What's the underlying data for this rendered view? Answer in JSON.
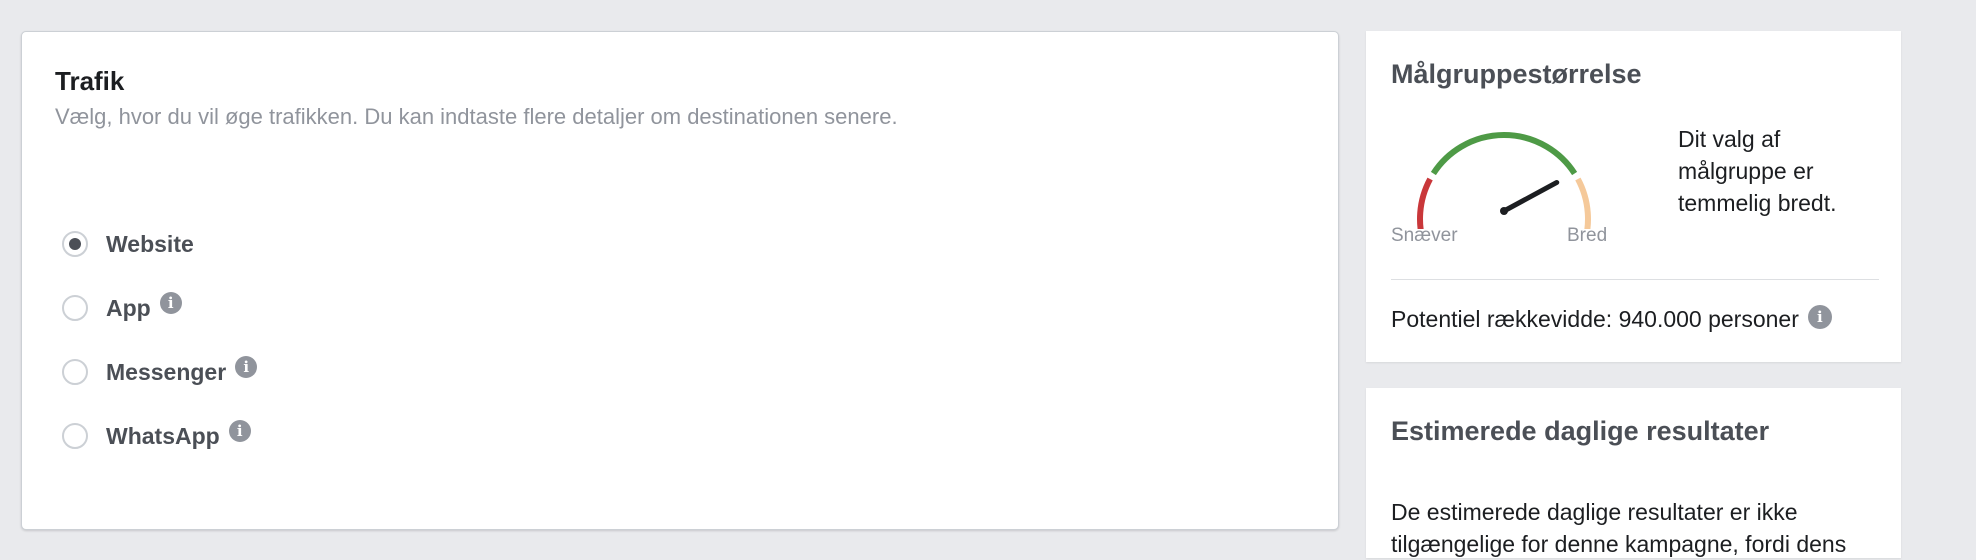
{
  "traffic": {
    "title": "Trafik",
    "subtitle": "Vælg, hvor du vil øge trafikken. Du kan indtaste flere detaljer om destinationen senere.",
    "options": [
      {
        "label": "Website",
        "checked": true,
        "info": false
      },
      {
        "label": "App",
        "checked": false,
        "info": true
      },
      {
        "label": "Messenger",
        "checked": false,
        "info": true
      },
      {
        "label": "WhatsApp",
        "checked": false,
        "info": true
      }
    ]
  },
  "audience": {
    "title": "Målgruppestørrelse",
    "gauge_min_label": "Snæver",
    "gauge_max_label": "Bred",
    "gauge_level": 0.78,
    "description": "Dit valg af målgruppe er temmelig bredt.",
    "reach_text": "Potentiel rækkevidde: 940.000 personer",
    "colors": {
      "narrow": "#c9373a",
      "good": "#4e9a46",
      "broad": "#f5c99a",
      "needle": "#1c1e21"
    }
  },
  "daily": {
    "title": "Estimerede daglige resultater",
    "text": "De estimerede daglige resultater er ikke tilgængelige for denne kampagne, fordi dens"
  },
  "icons": {
    "info": "i"
  }
}
